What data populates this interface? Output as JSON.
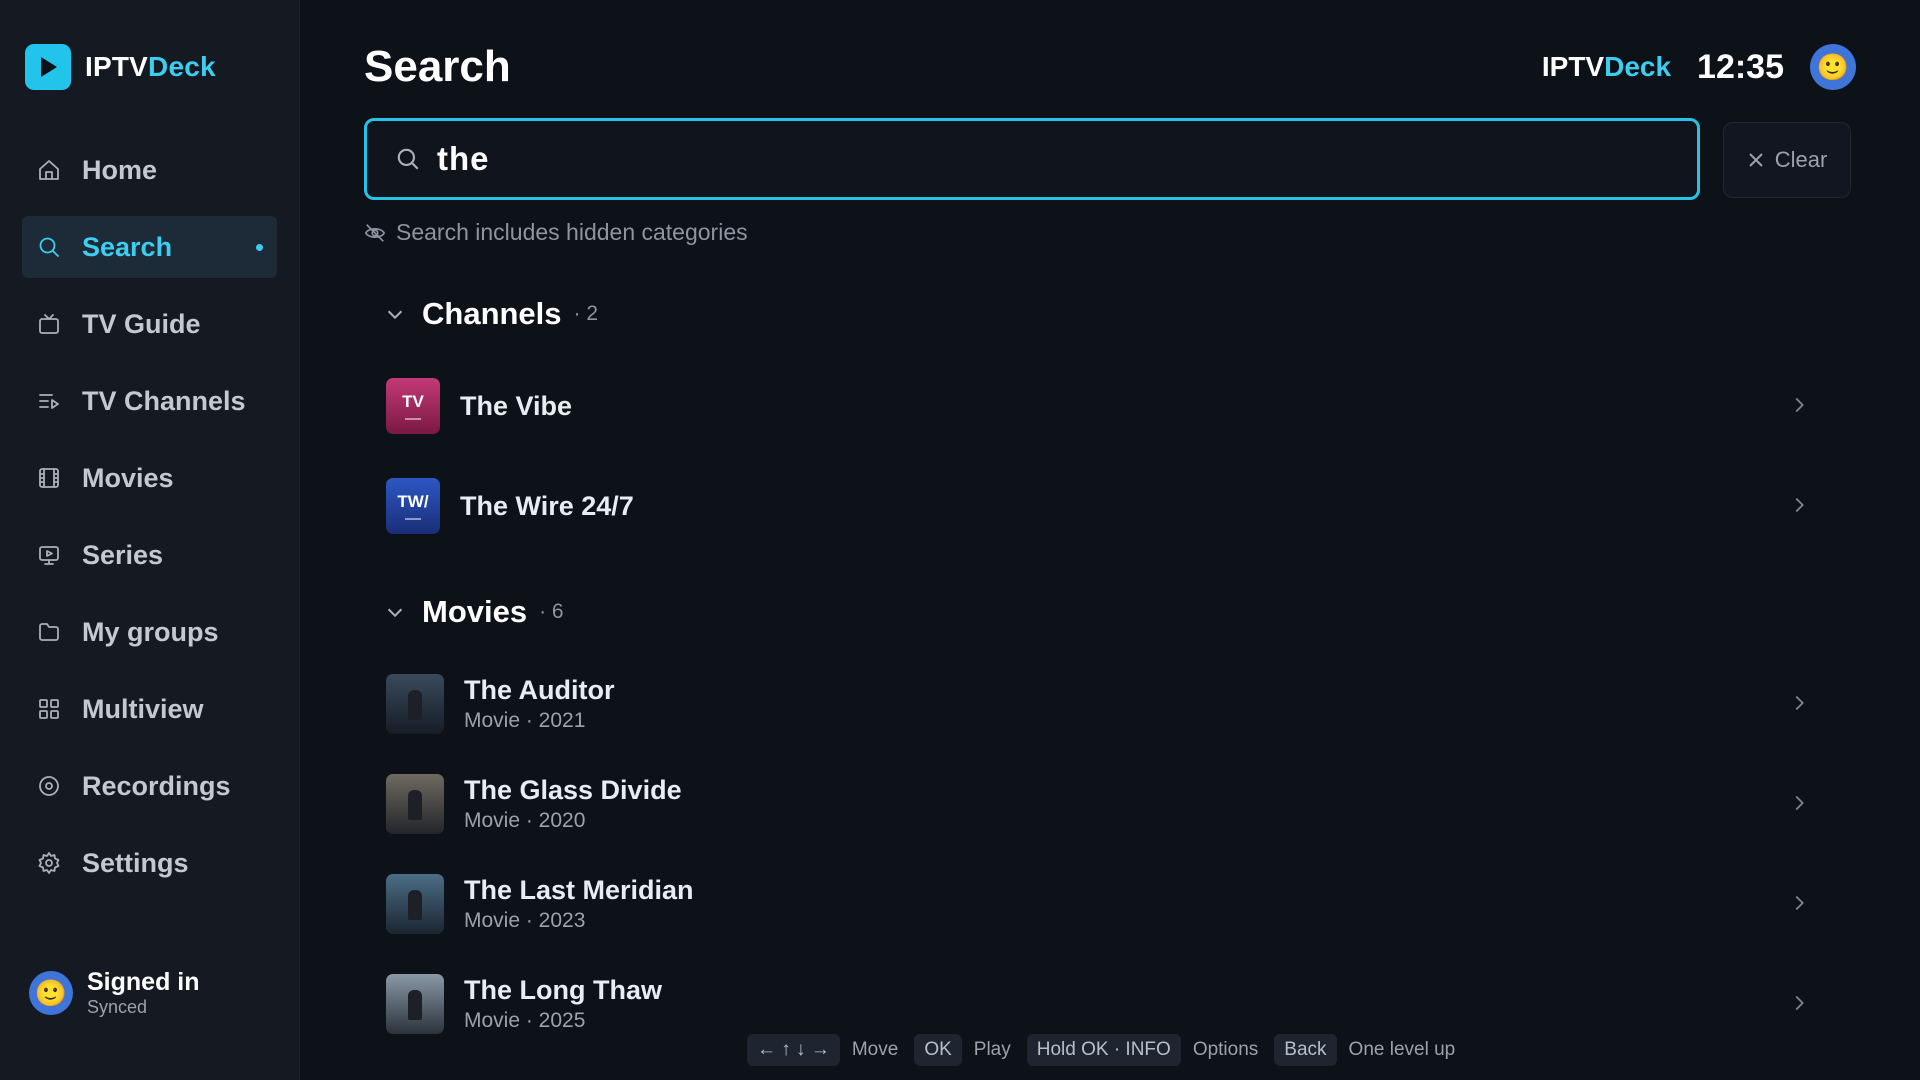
{
  "app": {
    "logo_part1": "IPTV",
    "logo_part2": "Deck",
    "accent": "#3ccdf0"
  },
  "sidebar": {
    "items": [
      {
        "label": "Home",
        "icon": "home-icon"
      },
      {
        "label": "Search",
        "icon": "search-icon",
        "active": true
      },
      {
        "label": "TV Guide",
        "icon": "tv-icon"
      },
      {
        "label": "TV Channels",
        "icon": "list-play-icon"
      },
      {
        "label": "Movies",
        "icon": "film-icon"
      },
      {
        "label": "Series",
        "icon": "monitor-play-icon"
      },
      {
        "label": "My groups",
        "icon": "folder-icon"
      },
      {
        "label": "Multiview",
        "icon": "grid-icon"
      },
      {
        "label": "Recordings",
        "icon": "disc-icon"
      },
      {
        "label": "Settings",
        "icon": "gear-icon"
      }
    ],
    "user": {
      "name": "Signed in",
      "status": "Synced",
      "avatar": "🙂"
    }
  },
  "header": {
    "title": "Search",
    "brand_part1": "IPTV",
    "brand_part2": "Deck",
    "clock": "12:35",
    "avatar": "🙂"
  },
  "search": {
    "value": "the",
    "clear_label": "Clear",
    "note": "Search includes hidden categories"
  },
  "channels": {
    "title": "Channels",
    "count": "· 2",
    "items": [
      {
        "title": "The Vibe",
        "thumb_text": "TV"
      },
      {
        "title": "The Wire 24/7",
        "thumb_text": "TW/"
      }
    ]
  },
  "movies": {
    "title": "Movies",
    "count": "· 6",
    "items": [
      {
        "title": "The Auditor",
        "sub": "Movie · 2021"
      },
      {
        "title": "The Glass Divide",
        "sub": "Movie · 2020"
      },
      {
        "title": "The Last Meridian",
        "sub": "Movie · 2023"
      },
      {
        "title": "The Long Thaw",
        "sub": "Movie · 2025"
      }
    ]
  },
  "footer": {
    "nav_keys": "← ↑ ↓ →",
    "move": "Move",
    "ok_key": "OK",
    "play": "Play",
    "hold_key": "Hold OK · INFO",
    "options": "Options",
    "back_key": "Back",
    "up": "One level up"
  }
}
